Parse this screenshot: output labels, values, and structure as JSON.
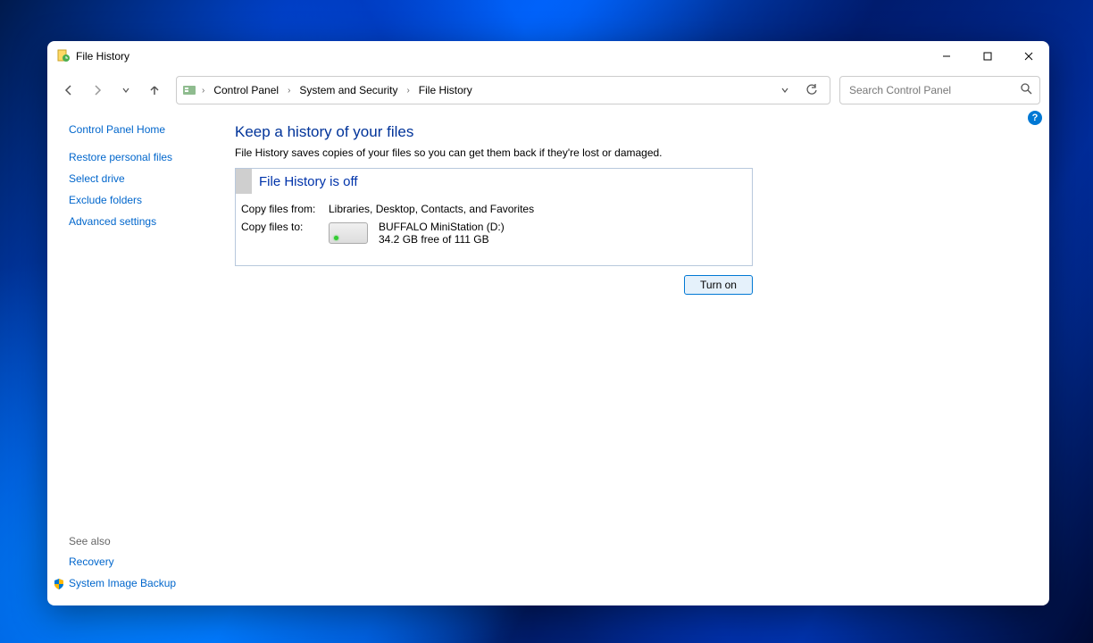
{
  "title": "File History",
  "breadcrumb": [
    "Control Panel",
    "System and Security",
    "File History"
  ],
  "search_placeholder": "Search Control Panel",
  "sidebar": {
    "home": "Control Panel Home",
    "links": [
      "Restore personal files",
      "Select drive",
      "Exclude folders",
      "Advanced settings"
    ],
    "see_also_header": "See also",
    "see_also": [
      "Recovery",
      "System Image Backup"
    ]
  },
  "page": {
    "heading": "Keep a history of your files",
    "description": "File History saves copies of your files so you can get them back if they're lost or damaged.",
    "status_banner": "File History is off",
    "copy_from_label": "Copy files from:",
    "copy_from_value": "Libraries, Desktop, Contacts, and Favorites",
    "copy_to_label": "Copy files to:",
    "drive_name": "BUFFALO MiniStation (D:)",
    "drive_space": "34.2 GB free of 111 GB",
    "action_button": "Turn on"
  }
}
